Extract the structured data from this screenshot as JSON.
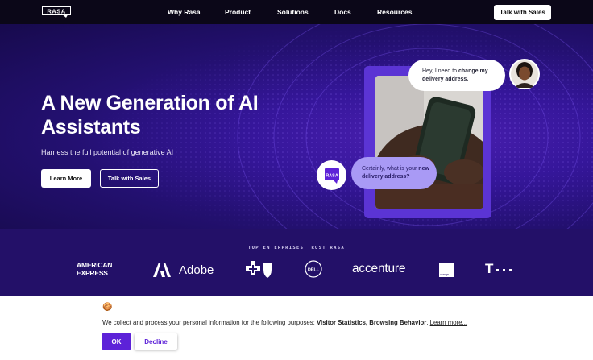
{
  "nav": {
    "logo_text": "RASA",
    "links": [
      "Why Rasa",
      "Product",
      "Solutions",
      "Docs",
      "Resources"
    ],
    "cta": "Talk with Sales"
  },
  "hero": {
    "title": "A New Generation of AI Assistants",
    "subtitle": "Harness the full potential of generative AI",
    "primary_button": "Learn More",
    "secondary_button": "Talk with Sales",
    "chat_user_plain": "Hey, I need to ",
    "chat_user_bold": "change my delivery address.",
    "chat_bot_plain": "Certainly, what is your ",
    "chat_bot_bold": "new delivery address?",
    "badge_text": "RASA"
  },
  "trust": {
    "label": "TOP ENTERPRISES TRUST RASA",
    "logos": [
      "AMERICAN EXPRESS",
      "Adobe",
      "BlueCross BlueShield",
      "DELL",
      "accenture",
      "orange",
      "T"
    ]
  },
  "cookie": {
    "icon": "🍪",
    "text_plain": "We collect and process your personal information for the following purposes: ",
    "text_bold": "Visitor Statistics, Browsing Behavior",
    "text_end": ". ",
    "learn_more": "Learn more...",
    "ok_label": "OK",
    "decline_label": "Decline"
  },
  "colors": {
    "nav_bg": "#0b0718",
    "hero_bg": "#231070",
    "accent": "#5d22d8",
    "bot_bubble": "#a99af5",
    "trust_bg": "#231068"
  }
}
